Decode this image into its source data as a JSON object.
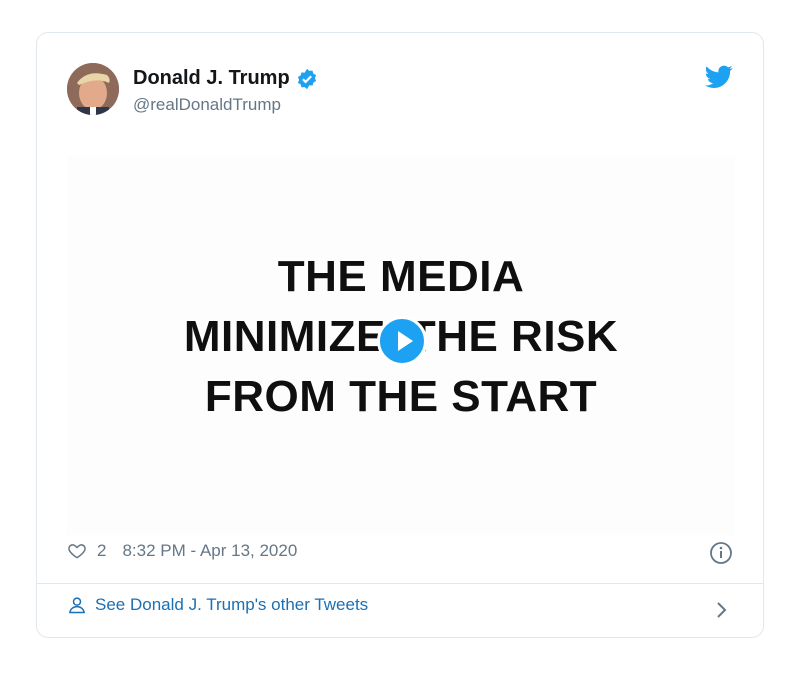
{
  "tweet": {
    "author_name": "Donald J. Trump",
    "handle": "@realDonaldTrump",
    "media_lines": [
      "THE MEDIA",
      "MINIMIZE’",
      "THE RISK",
      "FROM THE START"
    ],
    "like_count": "2",
    "timestamp": "8:32 PM - Apr 13, 2020",
    "footer_link": "See Donald J. Trump's other Tweets"
  },
  "icons": {
    "verified": "verified-badge-icon",
    "bird": "twitter-bird-icon",
    "heart": "heart-icon",
    "info": "info-icon",
    "person": "person-icon",
    "chevron": "chevron-right-icon",
    "play": "play-icon"
  },
  "colors": {
    "accent": "#1da1f2",
    "link": "#1b6fb3",
    "muted": "#657786",
    "border": "#e1e8ed"
  }
}
